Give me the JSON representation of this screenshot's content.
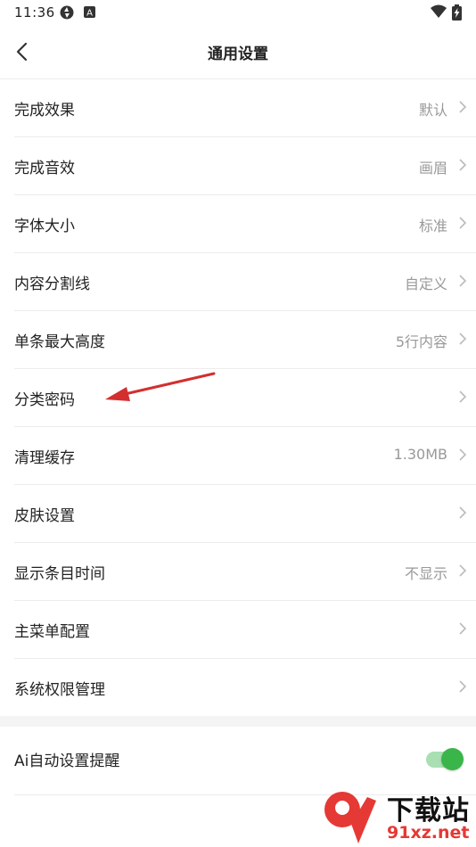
{
  "status_bar": {
    "time": "11:36"
  },
  "header": {
    "title": "通用设置"
  },
  "settings": [
    {
      "label": "完成效果",
      "value": "默认"
    },
    {
      "label": "完成音效",
      "value": "画眉"
    },
    {
      "label": "字体大小",
      "value": "标准"
    },
    {
      "label": "内容分割线",
      "value": "自定义"
    },
    {
      "label": "单条最大高度",
      "value": "5行内容"
    },
    {
      "label": "分类密码",
      "value": ""
    },
    {
      "label": "清理缓存",
      "value": "1.30MB"
    },
    {
      "label": "皮肤设置",
      "value": ""
    },
    {
      "label": "显示条目时间",
      "value": "不显示"
    },
    {
      "label": "主菜单配置",
      "value": ""
    },
    {
      "label": "系统权限管理",
      "value": ""
    }
  ],
  "toggle_section": {
    "label": "Ai自动设置提醒",
    "enabled": true
  },
  "colors": {
    "accent_green": "#3ab54a",
    "annotation_red": "#d32f2f",
    "value_gray": "#999999"
  },
  "icons": [
    "back-arrow-icon",
    "chevron-right-icon",
    "wifi-icon",
    "battery-charging-icon",
    "sync-icon",
    "a-badge-icon"
  ],
  "watermark": {
    "main": "下载站",
    "sub": "91xz.net"
  }
}
